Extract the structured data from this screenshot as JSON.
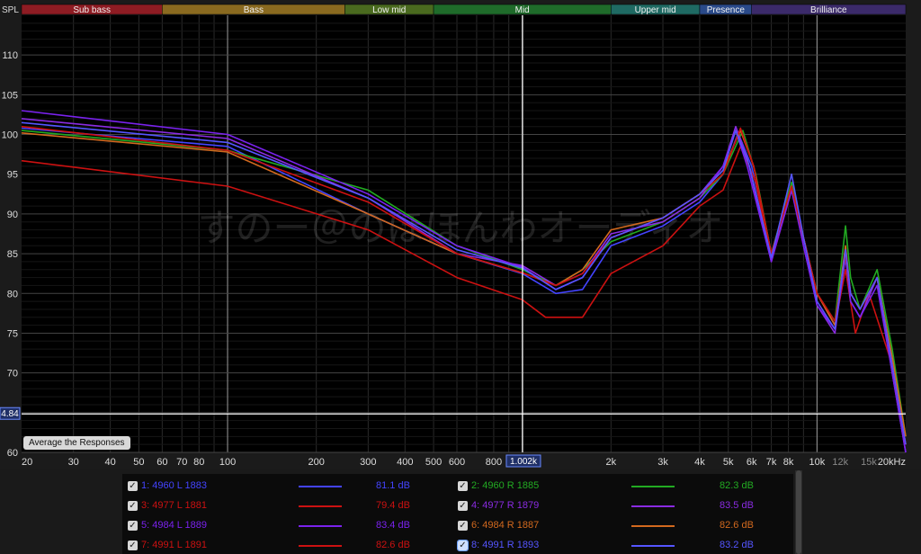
{
  "bands": [
    {
      "label": "Sub bass",
      "color": "#8e1c23"
    },
    {
      "label": "Bass",
      "color": "#8a6a20"
    },
    {
      "label": "Low mid",
      "color": "#4a6a1f"
    },
    {
      "label": "Mid",
      "color": "#1f6b2a"
    },
    {
      "label": "Upper mid",
      "color": "#1f6a63"
    },
    {
      "label": "Presence",
      "color": "#2a4a8a"
    },
    {
      "label": "Brilliance",
      "color": "#3b2a6a"
    }
  ],
  "y_axis_label": "SPL",
  "avg_button": "Average the Responses",
  "cursor": {
    "freq_label": "1.002k",
    "spl_label": "4.84"
  },
  "watermark": "すのー＠のほほんわオーディオ",
  "legend": [
    {
      "label": "1: 4960 L 1883",
      "value": "81.1 dB",
      "color": "#4444ff",
      "selected": false
    },
    {
      "label": "2: 4960 R 1885",
      "value": "82.3 dB",
      "color": "#22aa22",
      "selected": false
    },
    {
      "label": "3: 4977 L 1881",
      "value": "79.4 dB",
      "color": "#cc1111",
      "selected": false
    },
    {
      "label": "4: 4977 R 1879",
      "value": "83.5 dB",
      "color": "#8a2be2",
      "selected": false
    },
    {
      "label": "5: 4984 L 1889",
      "value": "83.4 dB",
      "color": "#7a22ee",
      "selected": false
    },
    {
      "label": "6: 4984 R 1887",
      "value": "82.6 dB",
      "color": "#d2691e",
      "selected": false
    },
    {
      "label": "7: 4991 L 1891",
      "value": "82.6 dB",
      "color": "#cc1111",
      "selected": false
    },
    {
      "label": "8: 4991 R 1893",
      "value": "83.2 dB",
      "color": "#5555ff",
      "selected": true
    }
  ],
  "chart_data": {
    "type": "line",
    "xscale": "log",
    "xlim": [
      20,
      20000
    ],
    "ylim": [
      60,
      115
    ],
    "yticks": [
      60,
      65,
      70,
      75,
      80,
      85,
      90,
      95,
      100,
      105,
      110
    ],
    "xticks": [
      {
        "v": 20,
        "label": "20"
      },
      {
        "v": 30,
        "label": "30"
      },
      {
        "v": 40,
        "label": "40"
      },
      {
        "v": 50,
        "label": "50"
      },
      {
        "v": 60,
        "label": "60"
      },
      {
        "v": 70,
        "label": "70"
      },
      {
        "v": 80,
        "label": "80"
      },
      {
        "v": 100,
        "label": "100"
      },
      {
        "v": 200,
        "label": "200"
      },
      {
        "v": 300,
        "label": "300"
      },
      {
        "v": 400,
        "label": "400"
      },
      {
        "v": 500,
        "label": "500"
      },
      {
        "v": 600,
        "label": "600"
      },
      {
        "v": 800,
        "label": "800"
      },
      {
        "v": 2000,
        "label": "2k"
      },
      {
        "v": 3000,
        "label": "3k"
      },
      {
        "v": 4000,
        "label": "4k"
      },
      {
        "v": 5000,
        "label": "5k"
      },
      {
        "v": 6000,
        "label": "6k"
      },
      {
        "v": 7000,
        "label": "7k"
      },
      {
        "v": 8000,
        "label": "8k"
      },
      {
        "v": 10000,
        "label": "10k"
      },
      {
        "v": 12000,
        "label": "12k",
        "dim": true
      },
      {
        "v": 15000,
        "label": "15k",
        "dim": true
      },
      {
        "v": 20000,
        "label": "20kHz"
      }
    ],
    "cursor_freq": 1002,
    "cursor_spl": 64.84,
    "series": [
      {
        "name": "1: 4960 L 1883",
        "color": "#4444ff",
        "points": [
          [
            20,
            100.8
          ],
          [
            100,
            98.5
          ],
          [
            300,
            90
          ],
          [
            600,
            85
          ],
          [
            1000,
            82.5
          ],
          [
            1300,
            80
          ],
          [
            1600,
            80.5
          ],
          [
            2000,
            86
          ],
          [
            3000,
            88.5
          ],
          [
            4000,
            91.5
          ],
          [
            4800,
            95
          ],
          [
            5400,
            100.2
          ],
          [
            6000,
            96
          ],
          [
            7000,
            85
          ],
          [
            8200,
            93
          ],
          [
            9000,
            87
          ],
          [
            10000,
            80
          ],
          [
            11500,
            76
          ],
          [
            12500,
            84.5
          ],
          [
            13000,
            80
          ],
          [
            14000,
            78
          ],
          [
            16000,
            82
          ],
          [
            18000,
            71
          ],
          [
            20000,
            61
          ]
        ]
      },
      {
        "name": "2: 4960 R 1885",
        "color": "#22aa22",
        "points": [
          [
            20,
            100.5
          ],
          [
            100,
            98
          ],
          [
            300,
            93
          ],
          [
            600,
            86
          ],
          [
            1000,
            83
          ],
          [
            1300,
            81
          ],
          [
            1600,
            83
          ],
          [
            2000,
            86.5
          ],
          [
            3000,
            89
          ],
          [
            4000,
            92
          ],
          [
            4800,
            95
          ],
          [
            5600,
            100.5
          ],
          [
            6200,
            95
          ],
          [
            7000,
            85
          ],
          [
            8200,
            94
          ],
          [
            9000,
            87
          ],
          [
            10000,
            80
          ],
          [
            11500,
            76.5
          ],
          [
            12500,
            88.5
          ],
          [
            13000,
            82
          ],
          [
            14000,
            78
          ],
          [
            16000,
            83
          ],
          [
            18000,
            73
          ],
          [
            20000,
            62
          ]
        ]
      },
      {
        "name": "3: 4977 L 1881",
        "color": "#cc1111",
        "points": [
          [
            20,
            96.7
          ],
          [
            100,
            93.5
          ],
          [
            300,
            88
          ],
          [
            600,
            82
          ],
          [
            1000,
            79.2
          ],
          [
            1200,
            77
          ],
          [
            1600,
            77
          ],
          [
            2000,
            82.5
          ],
          [
            3000,
            86
          ],
          [
            4000,
            91
          ],
          [
            4800,
            93
          ],
          [
            5500,
            98.5
          ],
          [
            6200,
            94
          ],
          [
            7000,
            84
          ],
          [
            8200,
            93
          ],
          [
            9000,
            87
          ],
          [
            10000,
            80
          ],
          [
            11500,
            76
          ],
          [
            12500,
            83
          ],
          [
            13500,
            75
          ],
          [
            15000,
            80
          ],
          [
            18000,
            71
          ],
          [
            20000,
            61
          ]
        ]
      },
      {
        "name": "4: 4977 R 1879",
        "color": "#8a2be2",
        "points": [
          [
            20,
            102
          ],
          [
            100,
            99.5
          ],
          [
            300,
            92
          ],
          [
            600,
            85
          ],
          [
            1000,
            83.5
          ],
          [
            1300,
            81
          ],
          [
            1600,
            82.5
          ],
          [
            2000,
            87.5
          ],
          [
            3000,
            89
          ],
          [
            4000,
            92
          ],
          [
            4800,
            96
          ],
          [
            5300,
            101
          ],
          [
            5800,
            97
          ],
          [
            7000,
            84
          ],
          [
            8200,
            93.5
          ],
          [
            9000,
            86
          ],
          [
            10000,
            78.5
          ],
          [
            11500,
            75
          ],
          [
            12500,
            85
          ],
          [
            13000,
            79
          ],
          [
            14000,
            77
          ],
          [
            16000,
            82
          ],
          [
            18000,
            70
          ],
          [
            20000,
            60
          ]
        ]
      },
      {
        "name": "5: 4984 L 1889",
        "color": "#7a22ee",
        "points": [
          [
            20,
            103
          ],
          [
            100,
            100
          ],
          [
            300,
            92.5
          ],
          [
            600,
            86
          ],
          [
            1000,
            83.3
          ],
          [
            1300,
            80.5
          ],
          [
            1600,
            82
          ],
          [
            2000,
            87
          ],
          [
            3000,
            89.5
          ],
          [
            4000,
            92.5
          ],
          [
            4800,
            96
          ],
          [
            5300,
            100.5
          ],
          [
            5800,
            96
          ],
          [
            7000,
            84
          ],
          [
            8200,
            93
          ],
          [
            9000,
            86
          ],
          [
            10000,
            78.5
          ],
          [
            11500,
            75.5
          ],
          [
            12500,
            84.5
          ],
          [
            13000,
            79
          ],
          [
            14000,
            77
          ],
          [
            16000,
            81
          ],
          [
            18000,
            70
          ],
          [
            20000,
            60
          ]
        ]
      },
      {
        "name": "6: 4984 R 1887",
        "color": "#d2691e",
        "points": [
          [
            20,
            100.2
          ],
          [
            100,
            97.8
          ],
          [
            300,
            90
          ],
          [
            600,
            85
          ],
          [
            1000,
            82.6
          ],
          [
            1300,
            81
          ],
          [
            1600,
            83
          ],
          [
            2000,
            88
          ],
          [
            3000,
            89.5
          ],
          [
            4000,
            92.5
          ],
          [
            4800,
            95.5
          ],
          [
            5500,
            100.5
          ],
          [
            6100,
            96
          ],
          [
            7000,
            85
          ],
          [
            8200,
            93.5
          ],
          [
            9000,
            87
          ],
          [
            10000,
            80
          ],
          [
            11500,
            76
          ],
          [
            12500,
            86
          ],
          [
            13000,
            80
          ],
          [
            14000,
            78
          ],
          [
            16000,
            82
          ],
          [
            18000,
            72
          ],
          [
            20000,
            62
          ]
        ]
      },
      {
        "name": "7: 4991 L 1891",
        "color": "#cc1111",
        "points": [
          [
            20,
            101
          ],
          [
            100,
            98
          ],
          [
            300,
            91.5
          ],
          [
            600,
            85
          ],
          [
            1000,
            82.6
          ],
          [
            1300,
            81
          ],
          [
            1600,
            82.5
          ],
          [
            2000,
            87
          ],
          [
            3000,
            89.5
          ],
          [
            4000,
            92.5
          ],
          [
            4800,
            95
          ],
          [
            5500,
            100.8
          ],
          [
            6100,
            96
          ],
          [
            7000,
            85
          ],
          [
            8200,
            93.5
          ],
          [
            9000,
            87
          ],
          [
            10000,
            80
          ],
          [
            11500,
            76.5
          ],
          [
            12500,
            85
          ],
          [
            13000,
            80
          ],
          [
            14000,
            78
          ],
          [
            16000,
            82
          ],
          [
            18000,
            71
          ],
          [
            20000,
            61
          ]
        ]
      },
      {
        "name": "8: 4991 R 1893",
        "color": "#5555ff",
        "points": [
          [
            20,
            101.5
          ],
          [
            100,
            99
          ],
          [
            300,
            92
          ],
          [
            600,
            85.5
          ],
          [
            1000,
            83.2
          ],
          [
            1300,
            80.5
          ],
          [
            1600,
            82
          ],
          [
            2000,
            87
          ],
          [
            3000,
            89.5
          ],
          [
            4000,
            92.5
          ],
          [
            4800,
            95.5
          ],
          [
            5300,
            100.5
          ],
          [
            5900,
            96
          ],
          [
            7000,
            84.5
          ],
          [
            8200,
            95
          ],
          [
            9000,
            87
          ],
          [
            10000,
            79
          ],
          [
            11500,
            75.5
          ],
          [
            12500,
            85.5
          ],
          [
            13000,
            80
          ],
          [
            14000,
            78
          ],
          [
            16000,
            82
          ],
          [
            18000,
            71
          ],
          [
            20000,
            61
          ]
        ]
      }
    ]
  }
}
